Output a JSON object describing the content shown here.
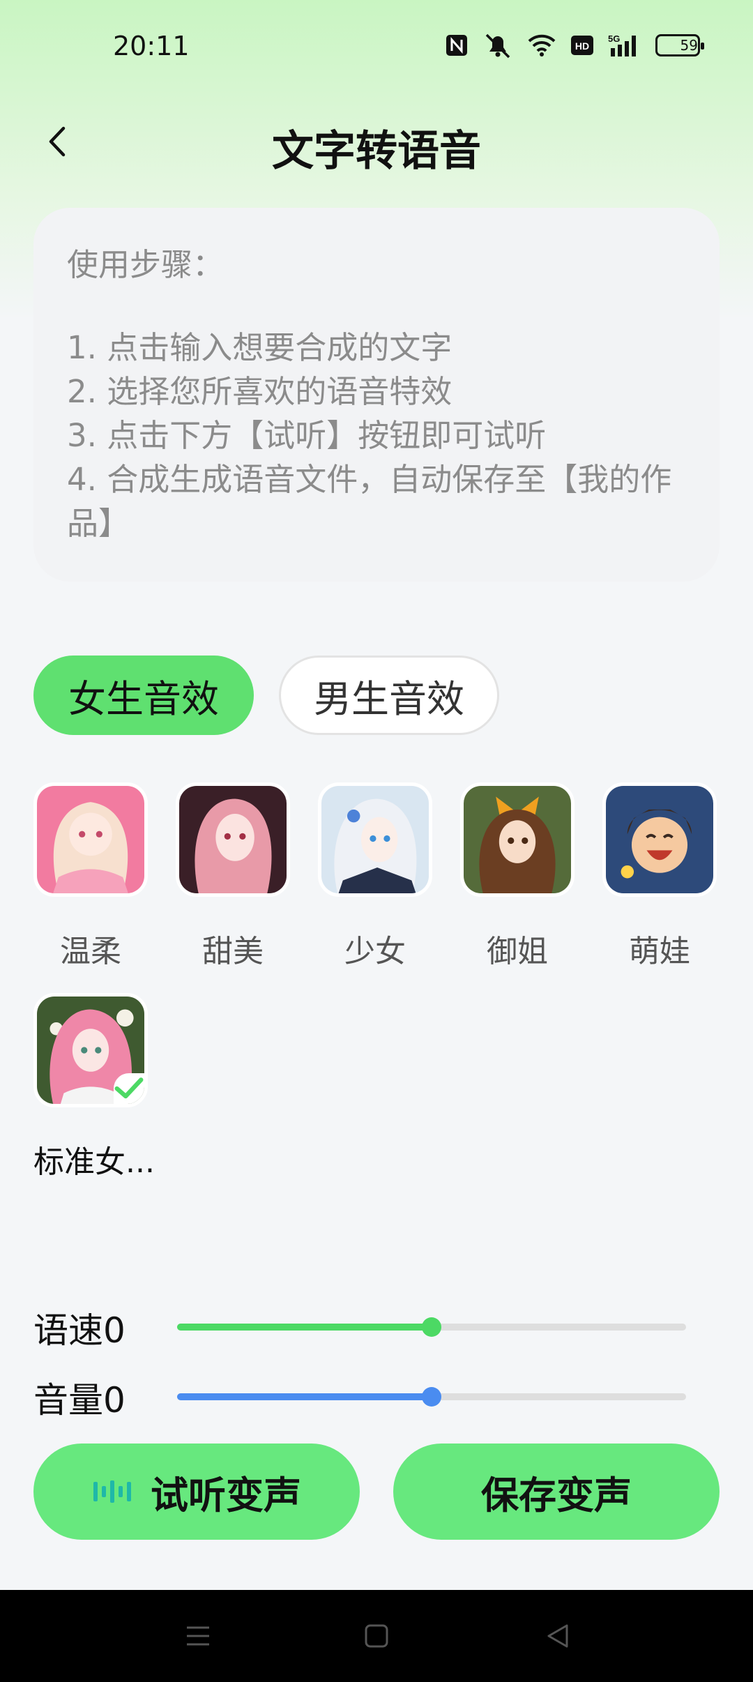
{
  "status_bar": {
    "time": "20:11",
    "icons": [
      "nfc-icon",
      "mute-icon",
      "wifi-icon",
      "hd-icon",
      "5g-signal-icon",
      "battery-icon"
    ],
    "battery_level": "59",
    "network": "5G",
    "hd": "HD"
  },
  "header": {
    "title": "文字转语音",
    "back_icon": "chevron-left-icon"
  },
  "instructions": {
    "title": "使用步骤：",
    "steps": [
      "1. 点击输入想要合成的文字",
      "2. 选择您所喜欢的语音特效",
      "3. 点击下方【试听】按钮即可试听",
      "4. 合成生成语音文件，自动保存至【我的作品】"
    ]
  },
  "tabs": [
    {
      "label": "女生音效",
      "active": true
    },
    {
      "label": "男生音效",
      "active": false
    }
  ],
  "voices": [
    {
      "label": "温柔",
      "selected": false
    },
    {
      "label": "甜美",
      "selected": false
    },
    {
      "label": "少女",
      "selected": false
    },
    {
      "label": "御姐",
      "selected": false
    },
    {
      "label": "萌娃",
      "selected": false
    },
    {
      "label": "标准女...",
      "selected": true
    }
  ],
  "sliders": {
    "speed": {
      "label": "语速0",
      "value_fraction": 0.5,
      "color": "#4cd964"
    },
    "volume": {
      "label": "音量0",
      "value_fraction": 0.5,
      "color": "#4a8cf0"
    }
  },
  "actions": {
    "preview_label": "试听变声",
    "save_label": "保存变声",
    "accent": "#67e87e"
  },
  "nav": {
    "icons": [
      "menu-icon",
      "home-square-icon",
      "back-triangle-icon"
    ]
  }
}
